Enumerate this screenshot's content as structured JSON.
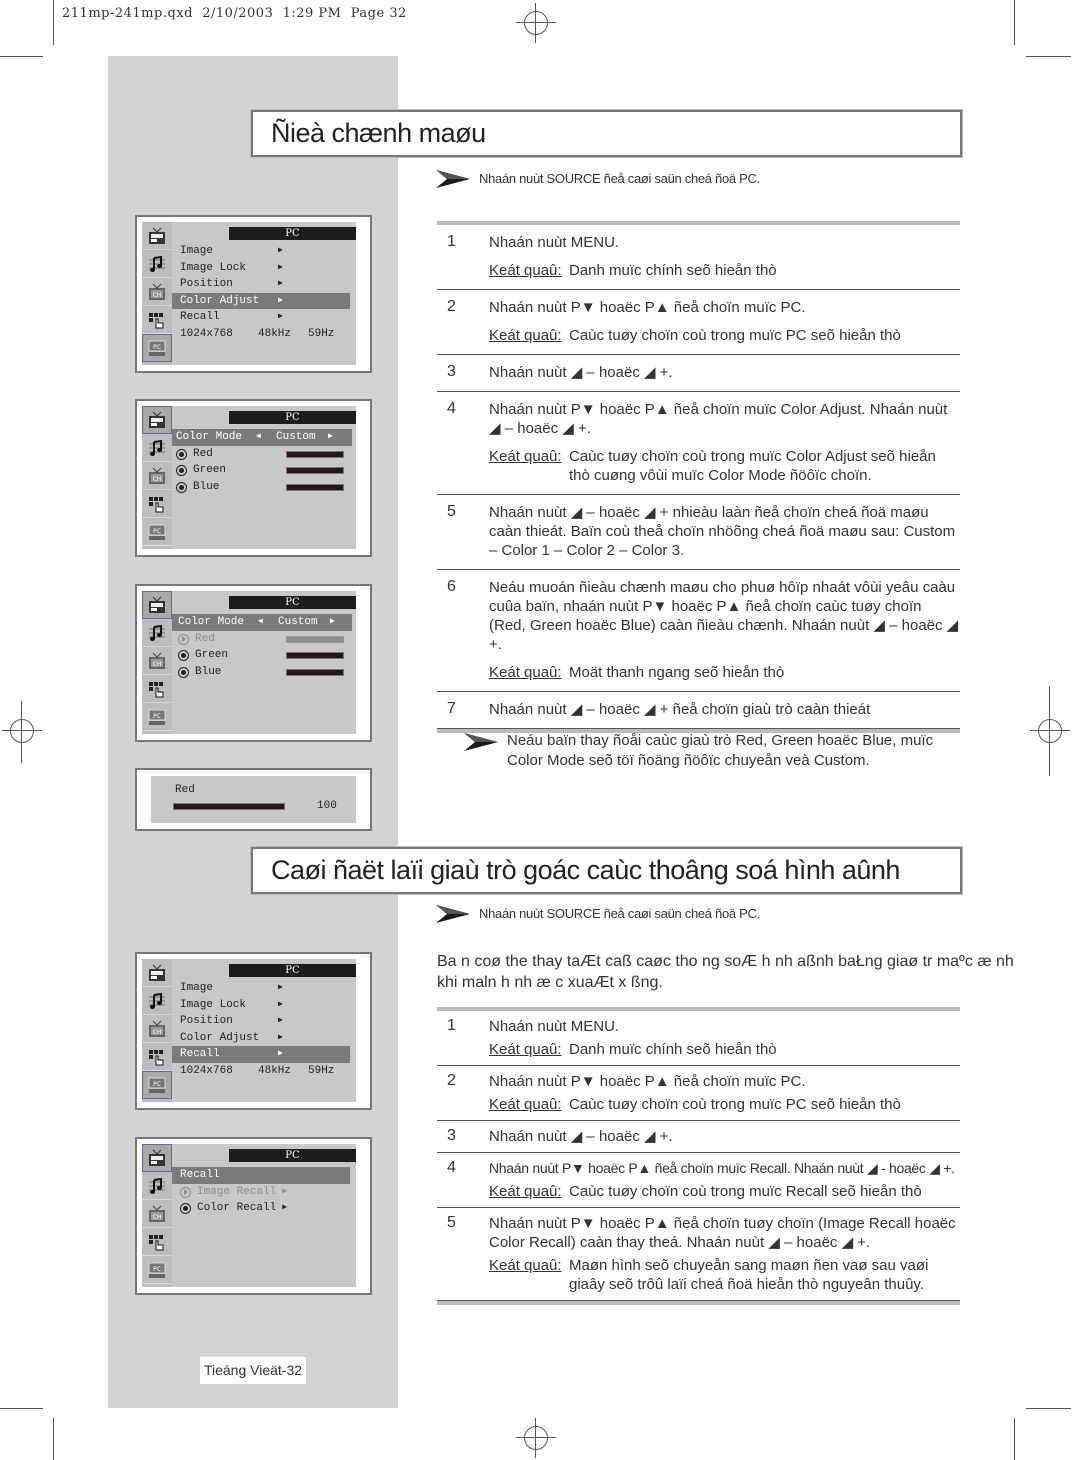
{
  "slug": "211mp-241mp.qxd  2/10/2003  1:29 PM  Page 32",
  "section1": {
    "title": "Ñieà chænh maøu",
    "source_note": "Nhaán nuùt SOURCE ñeå caøi saün cheá ñoä PC.",
    "steps": [
      {
        "num": "1",
        "text": "Nhaán nuùt MENU.",
        "result_label": "Keát quaû:",
        "result": "Danh muïc chính seõ hieån thò"
      },
      {
        "num": "2",
        "text": "Nhaán nuùt P▼ hoaëc P▲ ñeå choïn muïc PC.",
        "result_label": "Keát quaû:",
        "result": "Caùc tuøy choïn coù trong muïc PC seõ hieån thò"
      },
      {
        "num": "3",
        "text": "Nhaán nuùt ◢ – hoaëc ◢ +."
      },
      {
        "num": "4",
        "text": "Nhaán nuùt P▼ hoaëc P▲ ñeå choïn muïc Color Adjust. Nhaán nuùt ◢ – hoaëc ◢ +.",
        "result_label": "Keát quaû:",
        "result": "Caùc tuøy choïn coù trong muïc Color Adjust seõ hieån thò cuøng vôùi muïc Color Mode ñöôïc choïn."
      },
      {
        "num": "5",
        "text": "Nhaán nuùt ◢ – hoaëc ◢ + nhieàu laàn ñeå choïn cheá ñoä maøu caàn thieát. Baïn coù theå choïn nhöõng cheá ñoä maøu sau:   Custom – Color 1 – Color 2 – Color 3."
      },
      {
        "num": "6",
        "text": "Neáu muoán ñieàu chænh maøu cho phuø hôïp nhaát vôùi yeâu caàu cuûa baïn, nhaán nuùt P▼ hoaëc P▲ ñeå choïn caùc tuøy choïn (Red, Green hoaëc Blue) caàn ñieàu chænh. Nhaán nuùt ◢ – hoaëc ◢ +.",
        "result_label": "Keát quaû:",
        "result": "Moät thanh ngang seõ hieån thò"
      },
      {
        "num": "7",
        "text": "Nhaán nuùt ◢ – hoaëc ◢ + ñeå choïn giaù trò caàn thieát"
      }
    ],
    "tip": "Neáu baïn thay ñoåi caùc giaù trò Red, Green hoaëc Blue, muïc Color Mode seõ töï ñoäng ñöôïc chuyeån veà Custom."
  },
  "section2": {
    "title": "Caøi ñaët laïi giaù trò goác caùc thoâng soá hình aûnh",
    "source_note": "Nhaán nuùt SOURCE ñeå caøi saün cheá ñoä PC.",
    "intro": "Ba n coø the  thay taÆt caß caøc tho ng soÆ h nh aßnh baŁng giaø tr  maºc æ nh khi maln h nh æ   c xuaÆt x  ßng.",
    "steps": [
      {
        "num": "1",
        "text": "Nhaán nuùt MENU.",
        "result_label": "Keát quaû:",
        "result": "Danh muïc chính seõ hieån thò"
      },
      {
        "num": "2",
        "text": "Nhaán nuùt P▼ hoaëc P▲ ñeå choïn muïc PC.",
        "result_label": "Keát quaû:",
        "result": "Caùc tuøy choïn coù trong muïc PC seõ hieån thò"
      },
      {
        "num": "3",
        "text": "Nhaán nuùt ◢ – hoaëc ◢ +."
      },
      {
        "num": "4",
        "text": "Nhaán nuùt P▼ hoaëc P▲ ñeå choïn muïc Recall. Nhaán nuùt ◢ - hoaëc ◢ +.",
        "result_label": "Keát quaû:",
        "result": "Caùc tuøy choïn coù trong muïc Recall seõ hieån thò"
      },
      {
        "num": "5",
        "text": "Nhaán nuùt P▼ hoaëc P▲ ñeå choïn tuøy choïn (Image Recall hoaëc Color Recall) caàn thay theá. Nhaán nuùt ◢ – hoaëc ◢ +.",
        "result_label": "Keát quaû:",
        "result": "Maøn hình seõ chuyeån sang maøn ñen vaø sau vaøi giaây seõ trôû laïi cheá ñoä hieån thò nguyeân thuûy."
      }
    ]
  },
  "osd": {
    "header": "PC",
    "side_icons": [
      "picture-icon",
      "sound-icon",
      "channel-icon",
      "setup-icon",
      "pc-icon"
    ],
    "pc_menu": {
      "items": [
        "Image",
        "Image Lock",
        "Position",
        "Color Adjust",
        "Recall"
      ],
      "info": [
        "1024x768",
        "48kHz",
        "59Hz"
      ]
    },
    "color_menu": {
      "mode_label": "Color Mode",
      "mode_value": "Custom",
      "channels": [
        {
          "name": "Red",
          "level": 1.0
        },
        {
          "name": "Green",
          "level": 1.0
        },
        {
          "name": "Blue",
          "level": 1.0
        }
      ]
    },
    "gauge": {
      "label": "Red",
      "value": "100",
      "fraction": 1.0
    },
    "recall_menu": {
      "title": "Recall",
      "items": [
        "Image Recall",
        "Color Recall"
      ]
    }
  },
  "footer": {
    "page_label": "Tieáng Vieät-32"
  }
}
